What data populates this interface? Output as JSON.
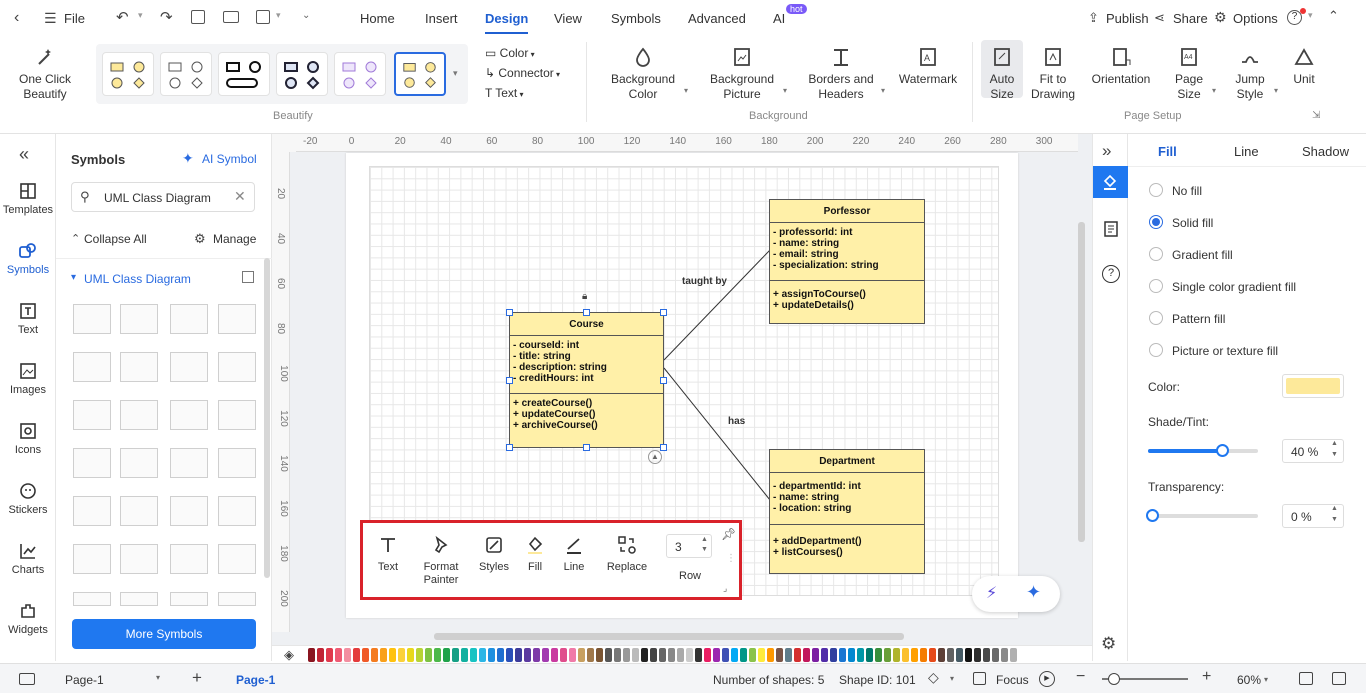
{
  "menubar": {
    "file": "File",
    "tabs": [
      "Home",
      "Insert",
      "Design",
      "View",
      "Symbols",
      "Advanced",
      "AI"
    ],
    "ai_badge": "hot",
    "publish": "Publish",
    "share": "Share",
    "options": "Options"
  },
  "ribbon": {
    "one_click": "One Click Beautify",
    "color": "Color",
    "connector": "Connector",
    "text": "Text",
    "beautify_label": "Beautify",
    "bg_color": "Background Color",
    "bg_picture": "Background Picture",
    "borders": "Borders and Headers",
    "watermark": "Watermark",
    "background_label": "Background",
    "auto_size": "Auto Size",
    "fit": "Fit to Drawing",
    "orientation": "Orientation",
    "page_size": "Page Size",
    "jump": "Jump Style",
    "unit": "Unit",
    "page_setup_label": "Page Setup"
  },
  "leftbar": [
    "Templates",
    "Symbols",
    "Text",
    "Images",
    "Icons",
    "Stickers",
    "Charts",
    "Widgets"
  ],
  "symbols": {
    "title": "Symbols",
    "ai_symbol": "AI Symbol",
    "search_value": "UML Class Diagram",
    "collapse": "Collapse All",
    "manage": "Manage",
    "library": "UML Class Diagram",
    "more": "More Symbols"
  },
  "ruler_h": [
    "-20",
    "0",
    "20",
    "40",
    "60",
    "80",
    "100",
    "120",
    "140",
    "160",
    "180",
    "200",
    "220",
    "240",
    "260",
    "280",
    "300"
  ],
  "ruler_v": [
    "20",
    "40",
    "60",
    "80",
    "100",
    "120",
    "140",
    "160",
    "180",
    "200"
  ],
  "diagram": {
    "course": {
      "name": "Course",
      "attrs": [
        "- courseId: int",
        "- title: string",
        "- description: string",
        "- creditHours: int"
      ],
      "ops": [
        "+ createCourse()",
        "+ updateCourse()",
        "+ archiveCourse()"
      ]
    },
    "professor": {
      "name": "Porfessor",
      "attrs": [
        "- professorId: int",
        "- name: string",
        "- email: string",
        "- specialization: string"
      ],
      "ops": [
        "+ assignToCourse()",
        "+ updateDetails()"
      ]
    },
    "department": {
      "name": "Department",
      "attrs": [
        "- departmentId: int",
        "- name: string",
        "- location: string"
      ],
      "ops": [
        "+ addDepartment()",
        "+ listCourses()"
      ]
    },
    "taught_by": "taught by",
    "has": "has"
  },
  "floatbar": {
    "text": "Text",
    "format": "Format Painter",
    "styles": "Styles",
    "fill": "Fill",
    "line": "Line",
    "replace": "Replace",
    "row": "Row",
    "row_value": "3"
  },
  "rpanel": {
    "tabs": [
      "Fill",
      "Line",
      "Shadow"
    ],
    "options": [
      "No fill",
      "Solid fill",
      "Gradient fill",
      "Single color gradient fill",
      "Pattern fill",
      "Picture or texture fill"
    ],
    "color_label": "Color:",
    "color_value": "#fde99a",
    "shade_label": "Shade/Tint:",
    "shade_value": "40 %",
    "shade_level": 0.45,
    "transparency_label": "Transparency:",
    "transparency_value": "0 %"
  },
  "palette": [
    "#8a1520",
    "#c02334",
    "#e0394c",
    "#ef5a73",
    "#f38ea0",
    "#e43b3b",
    "#f05a28",
    "#f47c20",
    "#f9a01b",
    "#ffc20e",
    "#fbd13a",
    "#e8d81c",
    "#b7d334",
    "#7dc242",
    "#4cb849",
    "#1fa24a",
    "#16a085",
    "#12b0a0",
    "#17c3c3",
    "#2bb6e6",
    "#1e90e0",
    "#1f6fd0",
    "#2a4fb8",
    "#3b3b9a",
    "#5b3aa0",
    "#7d3aa8",
    "#a23ab0",
    "#c93aa0",
    "#e04d8c",
    "#f07aa8",
    "#c8a060",
    "#a0784a",
    "#7a5533",
    "#555555",
    "#777777",
    "#999999",
    "#bbbbbb",
    "#222222",
    "#444444",
    "#666666",
    "#888888",
    "#aaaaaa",
    "#cccccc",
    "#333333",
    "#e91e63",
    "#9c27b0",
    "#3f51b5",
    "#03a9f4",
    "#009688",
    "#8bc34a",
    "#ffeb3b",
    "#ff9800",
    "#795548",
    "#607d8b",
    "#d32f2f",
    "#c2185b",
    "#7b1fa2",
    "#512da8",
    "#303f9f",
    "#1976d2",
    "#0288d1",
    "#0097a7",
    "#00796b",
    "#388e3c",
    "#689f38",
    "#afb42b",
    "#fbc02d",
    "#ffa000",
    "#f57c00",
    "#e64a19",
    "#5d4037",
    "#616161",
    "#455a64",
    "#111111",
    "#2d2d2d",
    "#4a4a4a",
    "#6a6a6a",
    "#8a8a8a",
    "#b0b0b0"
  ],
  "status": {
    "page_sel": "Page-1",
    "page_tab": "Page-1",
    "shapes": "Number of shapes: 5",
    "shape_id": "Shape ID: 101",
    "focus": "Focus",
    "zoom": "60%"
  }
}
